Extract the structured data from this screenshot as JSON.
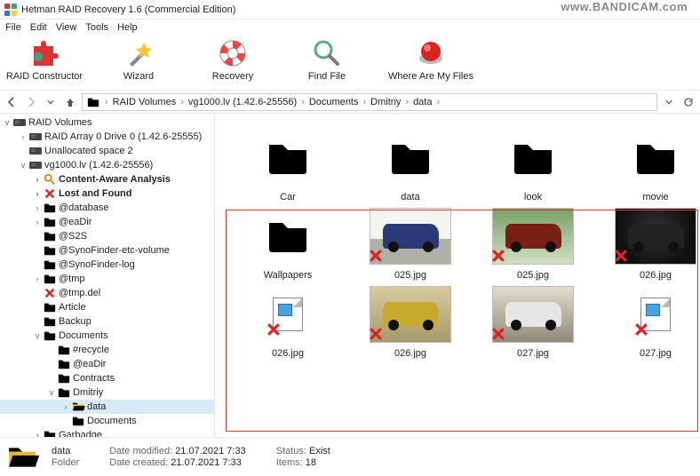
{
  "window_title": "Hetman RAID Recovery 1.6 (Commercial Edition)",
  "watermark": "www.BANDICAM.com",
  "menu": [
    "File",
    "Edit",
    "View",
    "Tools",
    "Help"
  ],
  "toolbar": [
    {
      "label": "RAID Constructor",
      "icon": "puzzle-icon"
    },
    {
      "label": "Wizard",
      "icon": "wizard-icon"
    },
    {
      "label": "Recovery",
      "icon": "lifebuoy-icon"
    },
    {
      "label": "Find File",
      "icon": "search-icon"
    },
    {
      "label": "Where Are My Files",
      "icon": "red-button-icon"
    }
  ],
  "breadcrumb": [
    "RAID Volumes",
    "vg1000.lv (1.42.6-25556)",
    "Documents",
    "Dmitriy",
    "data"
  ],
  "tree": {
    "root": "RAID Volumes",
    "items": [
      {
        "depth": 1,
        "twist": ">",
        "icon": "drive",
        "label": "RAID Array 0 Drive 0 (1.42.6-25555)"
      },
      {
        "depth": 1,
        "twist": "",
        "icon": "drive",
        "label": "Unallocated space 2"
      },
      {
        "depth": 1,
        "twist": "v",
        "icon": "drive",
        "label": "vg1000.lv (1.42.6-25556)"
      },
      {
        "depth": 2,
        "twist": ">",
        "icon": "search",
        "label": "Content-Aware Analysis",
        "bold": true
      },
      {
        "depth": 2,
        "twist": ">",
        "icon": "x",
        "label": "Lost and Found",
        "bold": true
      },
      {
        "depth": 2,
        "twist": ">",
        "icon": "folder",
        "label": "@database"
      },
      {
        "depth": 2,
        "twist": ">",
        "icon": "folder",
        "label": "@eaDir"
      },
      {
        "depth": 2,
        "twist": "",
        "icon": "folder",
        "label": "@S2S"
      },
      {
        "depth": 2,
        "twist": "",
        "icon": "folder",
        "label": "@SynoFinder-etc-volume"
      },
      {
        "depth": 2,
        "twist": "",
        "icon": "folder",
        "label": "@SynoFinder-log"
      },
      {
        "depth": 2,
        "twist": ">",
        "icon": "folder",
        "label": "@tmp"
      },
      {
        "depth": 2,
        "twist": "",
        "icon": "x",
        "label": "@tmp.del"
      },
      {
        "depth": 2,
        "twist": "",
        "icon": "folder",
        "label": "Article"
      },
      {
        "depth": 2,
        "twist": "",
        "icon": "folder",
        "label": "Backup"
      },
      {
        "depth": 2,
        "twist": "v",
        "icon": "folder",
        "label": "Documents"
      },
      {
        "depth": 3,
        "twist": "",
        "icon": "folder",
        "label": "#recycle"
      },
      {
        "depth": 3,
        "twist": "",
        "icon": "folder",
        "label": "@eaDir"
      },
      {
        "depth": 3,
        "twist": "",
        "icon": "folder",
        "label": "Contracts"
      },
      {
        "depth": 3,
        "twist": "v",
        "icon": "folder",
        "label": "Dmitriy"
      },
      {
        "depth": 4,
        "twist": ">",
        "icon": "folder-open",
        "label": "data",
        "sel": true
      },
      {
        "depth": 4,
        "twist": "",
        "icon": "folder",
        "label": "Documents"
      },
      {
        "depth": 2,
        "twist": ">",
        "icon": "folder",
        "label": "Garbadge"
      }
    ]
  },
  "files": [
    {
      "label": "Car",
      "type": "folder"
    },
    {
      "label": "data",
      "type": "folder"
    },
    {
      "label": "look",
      "type": "folder"
    },
    {
      "label": "movie",
      "type": "folder"
    },
    {
      "label": "Wallpapers",
      "type": "folder"
    },
    {
      "label": "025.jpg",
      "type": "image",
      "thumb": "car-a",
      "car": "#2a3a78",
      "deleted": true
    },
    {
      "label": "025.jpg",
      "type": "image",
      "thumb": "car-b",
      "car": "#7a1f16",
      "deleted": true
    },
    {
      "label": "026.jpg",
      "type": "image",
      "thumb": "car-c",
      "car": "#222",
      "deleted": true
    },
    {
      "label": "026.jpg",
      "type": "broken",
      "deleted": true
    },
    {
      "label": "026.jpg",
      "type": "image",
      "thumb": "car-d",
      "car": "#c8a92e",
      "deleted": true
    },
    {
      "label": "027.jpg",
      "type": "image",
      "thumb": "car-e",
      "car": "#e6e6e6",
      "deleted": true
    },
    {
      "label": "027.jpg",
      "type": "broken",
      "deleted": true
    }
  ],
  "status": {
    "name": "data",
    "type": "Folder",
    "modified_label": "Date modified:",
    "modified": "21.07.2021 7:33",
    "created_label": "Date created:",
    "created": "21.07.2021 7:33",
    "status_label": "Status:",
    "status_value": "Exist",
    "items_label": "Items:",
    "items_value": "18"
  }
}
